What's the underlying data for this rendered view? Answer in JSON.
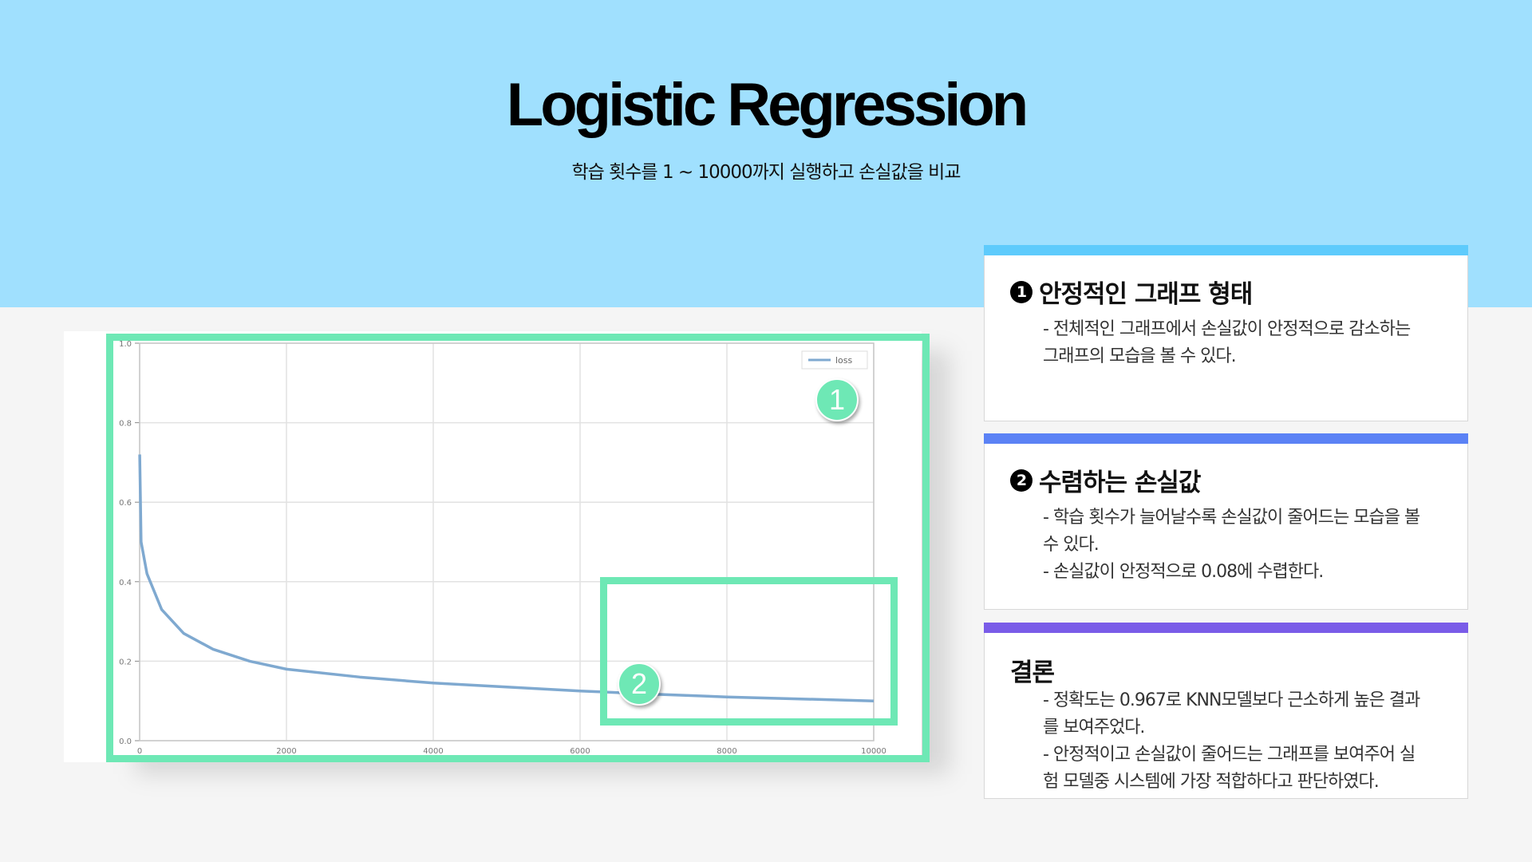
{
  "header": {
    "title": "Logistic Regression",
    "subtitle": "학습 횟수를 1 ~ 10000까지 실행하고 손실값을 비교"
  },
  "colors": {
    "top_band": "#a0e0fe",
    "highlight": "#6ee8b5",
    "card1_bar": "#5ecbfc",
    "card2_bar": "#5b82f5",
    "card3_bar": "#7a5ce8",
    "loss_line": "#7fa9d0"
  },
  "badges": {
    "one": "1",
    "two": "2"
  },
  "cards": [
    {
      "number": "1",
      "title": "안정적인 그래프 형태",
      "lines": [
        "- 전체적인 그래프에서 손실값이 안정적으로 감소하는",
        "그래프의 모습을 볼 수 있다."
      ]
    },
    {
      "number": "2",
      "title": "수렴하는 손실값",
      "lines": [
        "- 학습 횟수가 늘어날수록 손실값이 줄어드는 모습을 볼",
        "수 있다.",
        "- 손실값이 안정적으로 0.08에 수렵한다."
      ]
    },
    {
      "number": "",
      "title": "결론",
      "lines": [
        "- 정확도는 0.967로 KNN모델보다 근소하게 높은 결과",
        "를 보여주었다.",
        "- 안정적이고 손실값이 줄어드는 그래프를 보여주어 실",
        "험 모델중 시스템에 가장 적합하다고 판단하였다."
      ]
    }
  ],
  "chart_data": {
    "type": "line",
    "legend": "loss",
    "legend_position": "top-right",
    "grid": true,
    "x_ticks": [
      "0",
      "2000",
      "4000",
      "6000",
      "8000",
      "10000"
    ],
    "y_ticks": [
      "0.0",
      "0.2",
      "0.4",
      "0.6",
      "0.8",
      "1.0"
    ],
    "xlim": [
      0,
      10000
    ],
    "ylim": [
      0,
      1.0
    ],
    "series": [
      {
        "name": "loss",
        "x": [
          1,
          20,
          100,
          300,
          600,
          1000,
          1500,
          2000,
          3000,
          4000,
          5000,
          6000,
          7000,
          8000,
          9000,
          10000
        ],
        "y": [
          0.72,
          0.5,
          0.42,
          0.33,
          0.27,
          0.23,
          0.2,
          0.18,
          0.16,
          0.145,
          0.135,
          0.125,
          0.117,
          0.11,
          0.105,
          0.1
        ]
      }
    ]
  }
}
